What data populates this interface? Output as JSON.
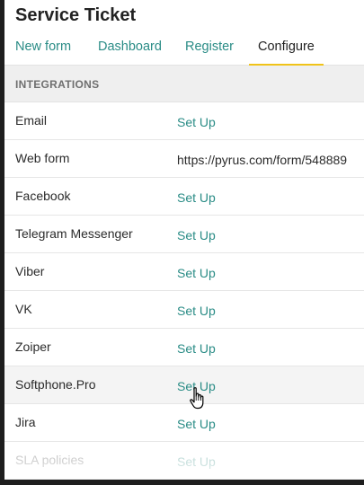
{
  "title": "Service Ticket",
  "tabs": [
    {
      "label": "New form",
      "active": false
    },
    {
      "label": "Dashboard",
      "active": false
    },
    {
      "label": "Register",
      "active": false
    },
    {
      "label": "Configure",
      "active": true
    }
  ],
  "section": {
    "label": "INTEGRATIONS"
  },
  "integrations": [
    {
      "name": "Email",
      "value": "Set Up"
    },
    {
      "name": "Web form",
      "value": "https://pyrus.com/form/548889"
    },
    {
      "name": "Facebook",
      "value": "Set Up"
    },
    {
      "name": "Telegram Messenger",
      "value": "Set Up"
    },
    {
      "name": "Viber",
      "value": "Set Up"
    },
    {
      "name": "VK",
      "value": "Set Up"
    },
    {
      "name": "Zoiper",
      "value": "Set Up"
    },
    {
      "name": "Softphone.Pro",
      "value": "Set Up"
    },
    {
      "name": "Jira",
      "value": "Set Up"
    },
    {
      "name": "SLA policies",
      "value": "Set Up"
    }
  ],
  "colors": {
    "accent": "#2a8c86",
    "tab_underline": "#f0c319",
    "background": "#1e1e1e"
  },
  "cursor": {
    "icon": "hand-pointer-icon"
  }
}
